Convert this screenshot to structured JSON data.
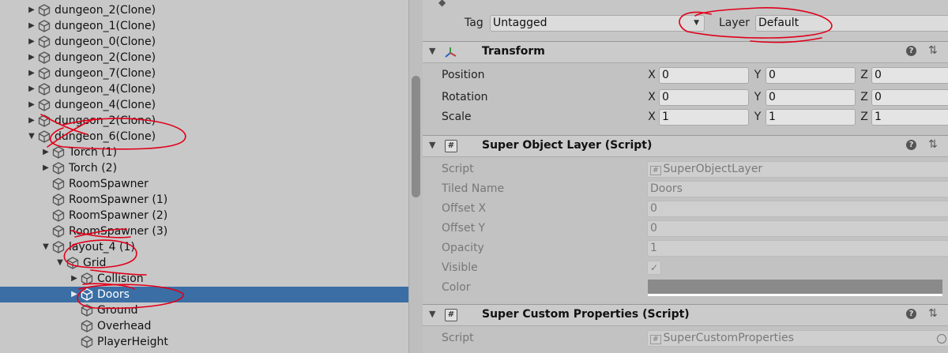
{
  "hierarchy": {
    "items": [
      {
        "label": "dungeon_2(Clone)",
        "indent": 0,
        "fold": "collapsed",
        "selected": false
      },
      {
        "label": "dungeon_1(Clone)",
        "indent": 0,
        "fold": "collapsed",
        "selected": false
      },
      {
        "label": "dungeon_0(Clone)",
        "indent": 0,
        "fold": "collapsed",
        "selected": false
      },
      {
        "label": "dungeon_2(Clone)",
        "indent": 0,
        "fold": "collapsed",
        "selected": false
      },
      {
        "label": "dungeon_7(Clone)",
        "indent": 0,
        "fold": "collapsed",
        "selected": false
      },
      {
        "label": "dungeon_4(Clone)",
        "indent": 0,
        "fold": "collapsed",
        "selected": false
      },
      {
        "label": "dungeon_4(Clone)",
        "indent": 0,
        "fold": "collapsed",
        "selected": false
      },
      {
        "label": "dungeon_2(Clone)",
        "indent": 0,
        "fold": "collapsed",
        "selected": false
      },
      {
        "label": "dungeon_6(Clone)",
        "indent": 0,
        "fold": "expanded",
        "selected": false
      },
      {
        "label": "Torch (1)",
        "indent": 1,
        "fold": "collapsed",
        "selected": false
      },
      {
        "label": "Torch (2)",
        "indent": 1,
        "fold": "collapsed",
        "selected": false
      },
      {
        "label": "RoomSpawner",
        "indent": 1,
        "fold": "none",
        "selected": false
      },
      {
        "label": "RoomSpawner (1)",
        "indent": 1,
        "fold": "none",
        "selected": false
      },
      {
        "label": "RoomSpawner (2)",
        "indent": 1,
        "fold": "none",
        "selected": false
      },
      {
        "label": "RoomSpawner (3)",
        "indent": 1,
        "fold": "none",
        "selected": false
      },
      {
        "label": "layout_4 (1)",
        "indent": 1,
        "fold": "expanded",
        "selected": false
      },
      {
        "label": "Grid",
        "indent": 2,
        "fold": "expanded",
        "selected": false
      },
      {
        "label": "Collision",
        "indent": 3,
        "fold": "collapsed",
        "selected": false
      },
      {
        "label": "Doors",
        "indent": 3,
        "fold": "collapsed",
        "selected": true
      },
      {
        "label": "Ground",
        "indent": 3,
        "fold": "none",
        "selected": false
      },
      {
        "label": "Overhead",
        "indent": 3,
        "fold": "none",
        "selected": false
      },
      {
        "label": "PlayerHeight",
        "indent": 3,
        "fold": "none",
        "selected": false
      }
    ]
  },
  "inspector": {
    "tag_label": "Tag",
    "tag_value": "Untagged",
    "layer_label": "Layer",
    "layer_value": "Default",
    "transform": {
      "title": "Transform",
      "rows": [
        {
          "label": "Position",
          "x": "0",
          "y": "0",
          "z": "0"
        },
        {
          "label": "Rotation",
          "x": "0",
          "y": "0",
          "z": "0"
        },
        {
          "label": "Scale",
          "x": "1",
          "y": "1",
          "z": "1"
        }
      ],
      "axis_x": "X",
      "axis_y": "Y",
      "axis_z": "Z"
    },
    "super_object_layer": {
      "title": "Super Object Layer (Script)",
      "script_label": "Script",
      "script_value": "SuperObjectLayer",
      "tiled_name_label": "Tiled Name",
      "tiled_name_value": "Doors",
      "offset_x_label": "Offset X",
      "offset_x_value": "0",
      "offset_y_label": "Offset Y",
      "offset_y_value": "0",
      "opacity_label": "Opacity",
      "opacity_value": "1",
      "visible_label": "Visible",
      "visible_checked": true,
      "color_label": "Color",
      "color_swatch": "#8a8a8a"
    },
    "super_custom_properties": {
      "title": "Super Custom Properties (Script)",
      "script_label": "Script",
      "script_value": "SuperCustomProperties"
    }
  },
  "icons": {
    "help": "?",
    "hash": "#",
    "checkmark": "✓",
    "dropdown": "▼",
    "settings": "⇅"
  },
  "colors": {
    "selection": "#3a6ea5",
    "annotation": "#e0001a"
  }
}
